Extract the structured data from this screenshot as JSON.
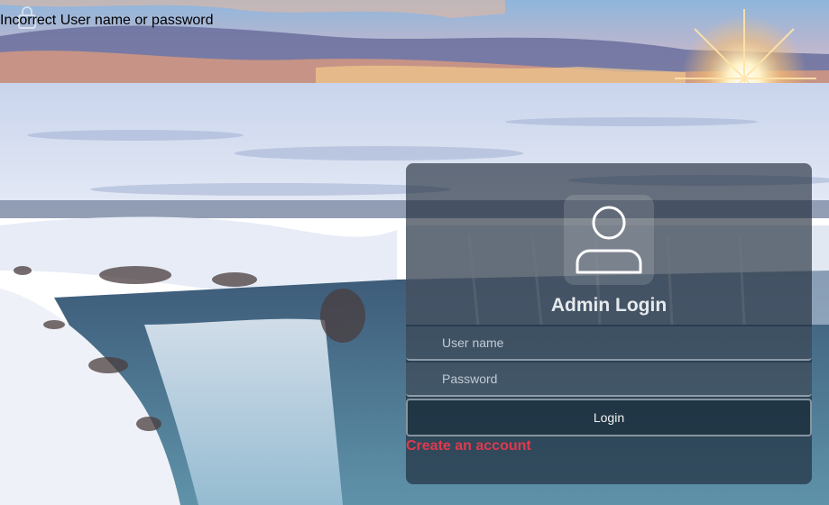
{
  "page": {
    "error_message": "Incorrect User name or password"
  },
  "login_panel": {
    "title": "Admin Login",
    "username_placeholder": "User name",
    "password_placeholder": "Password",
    "login_button": "Login",
    "create_account_link": "Create an account"
  },
  "icons": {
    "top": "lock-icon",
    "avatar": "user-icon"
  },
  "colors": {
    "link": "#e03a4e",
    "panel_bg": "rgba(25,35,50,0.62)",
    "title_text": "#e6eaee"
  }
}
